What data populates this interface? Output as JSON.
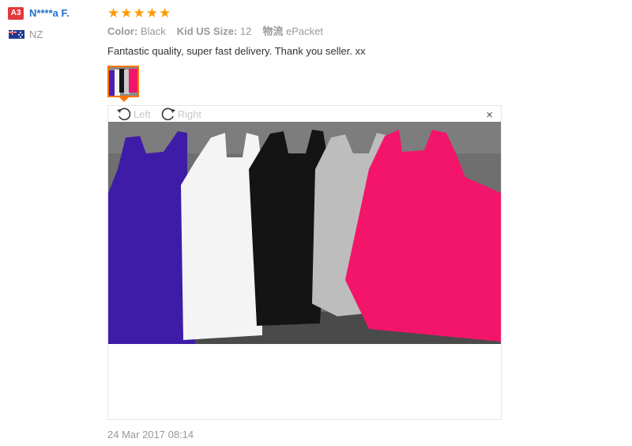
{
  "reviewer": {
    "level_badge": "A3",
    "name": "N****a F.",
    "country": "NZ",
    "flag_icon": "new-zealand-flag-icon"
  },
  "rating": {
    "stars": 5,
    "max": 5,
    "star_icon": "star-icon"
  },
  "attributes": [
    {
      "key": "Color:",
      "value": "Black"
    },
    {
      "key": "Kid US Size:",
      "value": "12"
    },
    {
      "key": "物流",
      "value": "ePacket"
    }
  ],
  "feedback_text": "Fantastic quality, super fast delivery. Thank you seller. xx",
  "viewer": {
    "rotate_left_label": "Left",
    "rotate_right_label": "Right",
    "close_label": "×"
  },
  "date": "24 Mar 2017 08:14",
  "colors": {
    "badge": "#e4393c",
    "name": "#2470c9",
    "star": "#ff9a00",
    "thumb_border": "#ff7300",
    "muted": "#999999"
  }
}
